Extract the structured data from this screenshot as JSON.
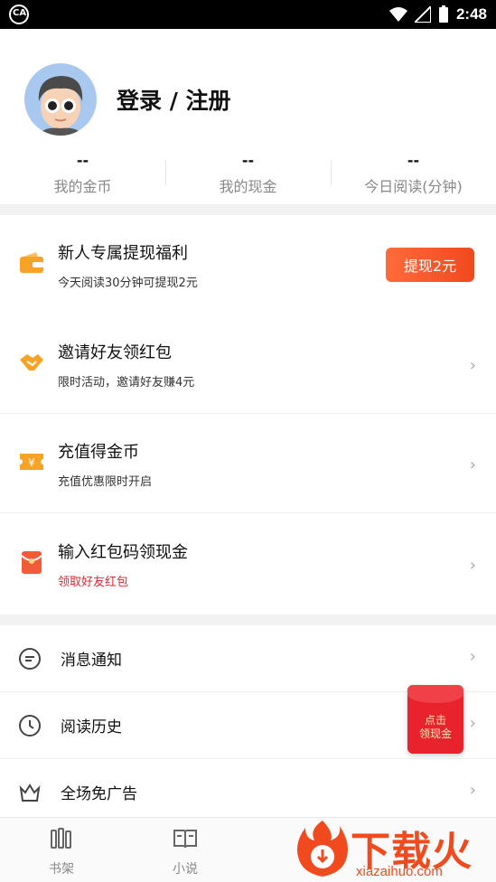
{
  "status_bar": {
    "time": "2:48",
    "app_badge": "CA"
  },
  "profile": {
    "title": "登录 / 注册",
    "stats": [
      {
        "value": "--",
        "label": "我的金币"
      },
      {
        "value": "--",
        "label": "我的现金"
      },
      {
        "value": "--",
        "label": "今日阅读(分钟)"
      }
    ]
  },
  "promos": [
    {
      "title": "新人专属提现福利",
      "subtitle": "今天阅读30分钟可提现2元",
      "button": "提现2元"
    },
    {
      "title": "邀请好友领红包",
      "subtitle": "限时活动，邀请好友赚4元"
    },
    {
      "title": "充值得金币",
      "subtitle": "充值优惠限时开启"
    },
    {
      "title": "输入红包码领现金",
      "subtitle": "领取好友红包"
    }
  ],
  "settings": [
    {
      "label": "消息通知"
    },
    {
      "label": "阅读历史"
    },
    {
      "label": "全场免广告"
    }
  ],
  "floating_packet": {
    "line1": "点击",
    "line2": "领现金"
  },
  "tabs": [
    {
      "label": "书架"
    },
    {
      "label": "小说"
    }
  ],
  "watermark": {
    "text": "下载火",
    "sub": "xiazaihuo.com"
  },
  "colors": {
    "accent": "#f0491e",
    "red_text": "#e0262f",
    "icon_orange": "#f7a326"
  }
}
